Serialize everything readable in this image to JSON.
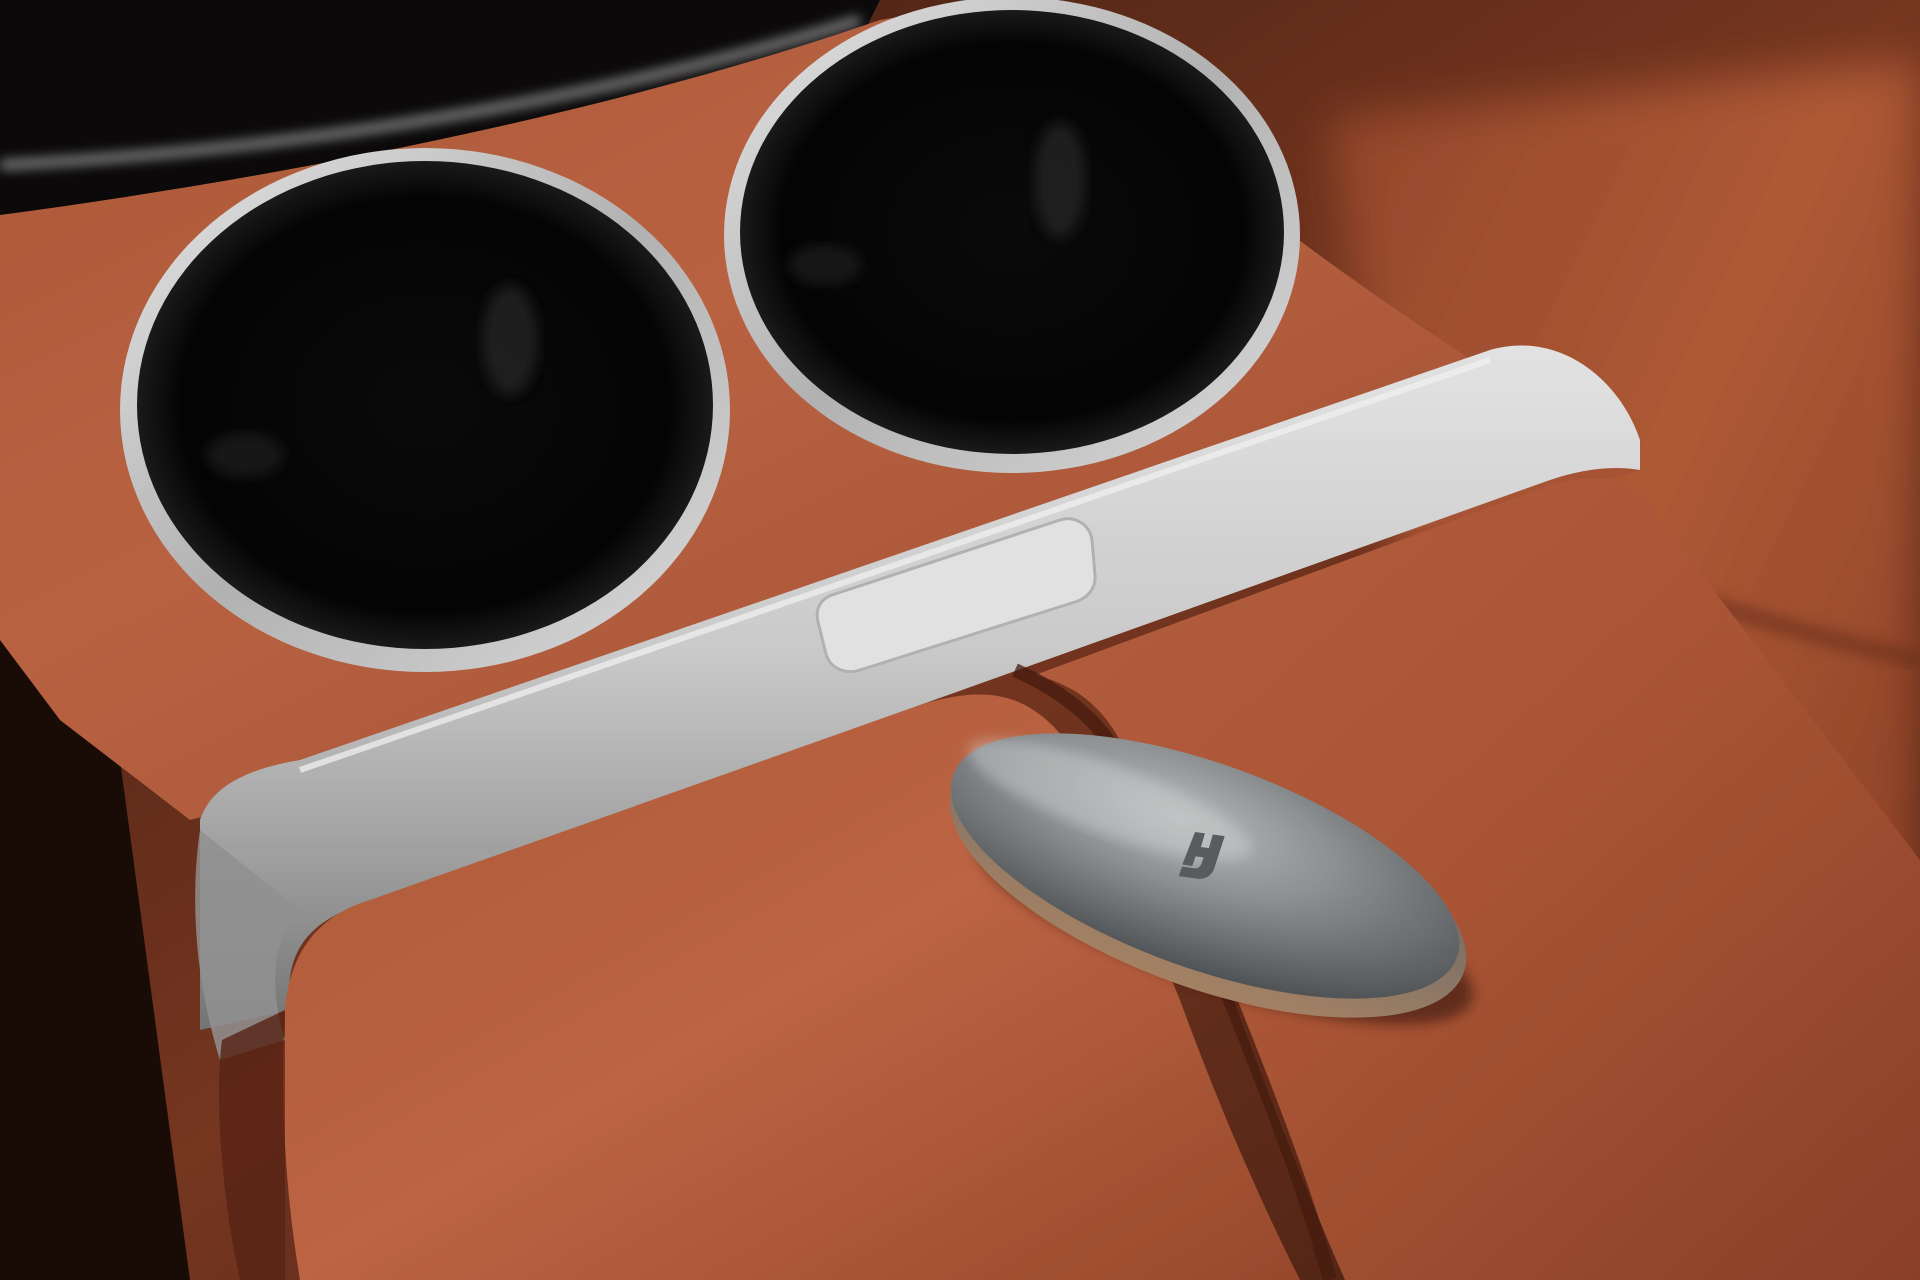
{
  "scene": {
    "subject": "key-fob-on-leather-armrest",
    "colors": {
      "leather_dark": "#8a3f24",
      "leather_mid": "#b15a37",
      "leather_light": "#cf7450",
      "chrome": "#d9d9d9",
      "cup_interior": "#050505",
      "fob_body": "#8f9294",
      "fob_logo": "#5f6265"
    },
    "icons": {
      "fob_logo": "stylized-h-logo-icon"
    }
  }
}
